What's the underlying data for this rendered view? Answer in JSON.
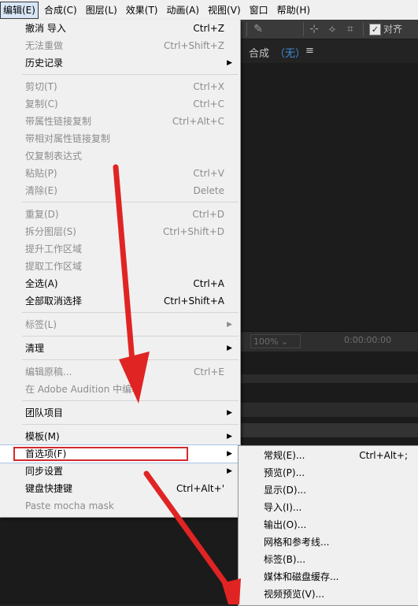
{
  "menubar": [
    "编辑(E)",
    "合成(C)",
    "图层(L)",
    "效果(T)",
    "动画(A)",
    "视图(V)",
    "窗口",
    "帮助(H)"
  ],
  "toolbar": {
    "align_label": "对齐",
    "align_checked": "✓"
  },
  "comp_panel": {
    "label": "合成",
    "value": "（无）",
    "menu_icon": "≡"
  },
  "viewer_bar": {
    "zoom": "100%",
    "timecode": "0:00:00:00"
  },
  "edit_menu": {
    "items": [
      {
        "label": "撤消 导入",
        "shortcut": "Ctrl+Z",
        "disabled": false
      },
      {
        "label": "无法重做",
        "shortcut": "Ctrl+Shift+Z",
        "disabled": true
      },
      {
        "label": "历史记录",
        "shortcut": "",
        "disabled": false,
        "submenu": true
      },
      {
        "label": "剪切(T)",
        "shortcut": "Ctrl+X",
        "disabled": true
      },
      {
        "label": "复制(C)",
        "shortcut": "Ctrl+C",
        "disabled": true
      },
      {
        "label": "带属性链接复制",
        "shortcut": "Ctrl+Alt+C",
        "disabled": true
      },
      {
        "label": "带相对属性链接复制",
        "shortcut": "",
        "disabled": true
      },
      {
        "label": "仅复制表达式",
        "shortcut": "",
        "disabled": true
      },
      {
        "label": "粘贴(P)",
        "shortcut": "Ctrl+V",
        "disabled": true
      },
      {
        "label": "清除(E)",
        "shortcut": "Delete",
        "disabled": true
      },
      {
        "label": "重复(D)",
        "shortcut": "Ctrl+D",
        "disabled": true
      },
      {
        "label": "拆分图层(S)",
        "shortcut": "Ctrl+Shift+D",
        "disabled": true
      },
      {
        "label": "提升工作区域",
        "shortcut": "",
        "disabled": true
      },
      {
        "label": "提取工作区域",
        "shortcut": "",
        "disabled": true
      },
      {
        "label": "全选(A)",
        "shortcut": "Ctrl+A",
        "disabled": false
      },
      {
        "label": "全部取消选择",
        "shortcut": "Ctrl+Shift+A",
        "disabled": false
      },
      {
        "label": "标签(L)",
        "shortcut": "",
        "disabled": true,
        "submenu": true
      },
      {
        "label": "清理",
        "shortcut": "",
        "disabled": false,
        "submenu": true
      },
      {
        "label": "编辑原稿...",
        "shortcut": "Ctrl+E",
        "disabled": true
      },
      {
        "label": "在 Adobe Audition 中编辑",
        "shortcut": "",
        "disabled": true
      },
      {
        "label": "团队项目",
        "shortcut": "",
        "disabled": false,
        "submenu": true
      },
      {
        "label": "模板(M)",
        "shortcut": "",
        "disabled": false,
        "submenu": true
      },
      {
        "label": "首选项(F)",
        "shortcut": "",
        "disabled": false,
        "submenu": true,
        "highlighted": true
      },
      {
        "label": "同步设置",
        "shortcut": "",
        "disabled": false,
        "submenu": true
      },
      {
        "label": "键盘快捷键",
        "shortcut": "Ctrl+Alt+'",
        "disabled": false
      },
      {
        "label": "Paste mocha mask",
        "shortcut": "",
        "disabled": true
      }
    ]
  },
  "prefs_submenu": {
    "items": [
      {
        "label": "常规(E)...",
        "shortcut": "Ctrl+Alt+;"
      },
      {
        "label": "预览(P)...",
        "shortcut": ""
      },
      {
        "label": "显示(D)...",
        "shortcut": ""
      },
      {
        "label": "导入(I)...",
        "shortcut": ""
      },
      {
        "label": "输出(O)...",
        "shortcut": ""
      },
      {
        "label": "网格和参考线...",
        "shortcut": ""
      },
      {
        "label": "标签(B)...",
        "shortcut": ""
      },
      {
        "label": "媒体和磁盘缓存...",
        "shortcut": ""
      },
      {
        "label": "视频预览(V)...",
        "shortcut": ""
      }
    ]
  },
  "colors": {
    "annotation_red": "#d12b2b",
    "comp_value_blue": "#3d8bd4",
    "menu_bg": "#f0f0f0",
    "app_bg": "#232323"
  },
  "icons": {
    "submenu_arrow": "▶",
    "pin": "📌",
    "zoom_caret": "⌄"
  }
}
